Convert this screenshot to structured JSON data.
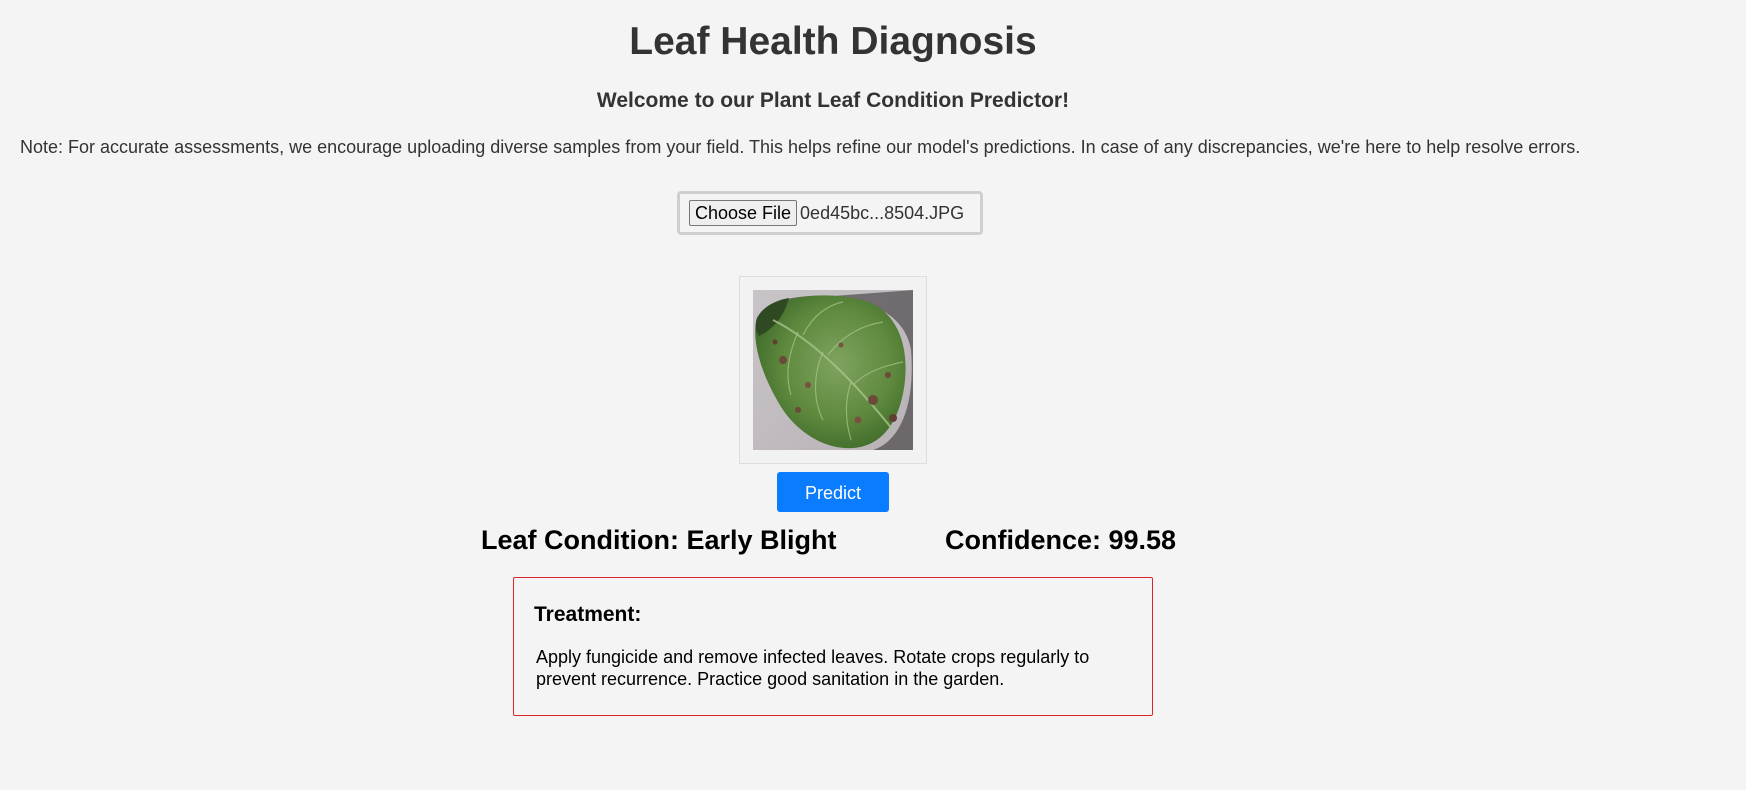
{
  "header": {
    "title": "Leaf Health Diagnosis",
    "welcome": "Welcome to our Plant Leaf Condition Predictor!",
    "note": "Note: For accurate assessments, we encourage uploading diverse samples from your field. This helps refine our model's predictions. In case of any discrepancies, we're here to help resolve errors."
  },
  "upload": {
    "button_label": "Choose File",
    "file_name": "0ed45bc...8504.JPG"
  },
  "preview": {
    "image_semantic": "leaf-photo"
  },
  "actions": {
    "predict_label": "Predict"
  },
  "result": {
    "condition_text": "Leaf Condition: Early Blight",
    "confidence_text": "Confidence: 99.58"
  },
  "treatment": {
    "title": "Treatment:",
    "text": "Apply fungicide and remove infected leaves. Rotate crops regularly to prevent recurrence. Practice good sanitation in the garden."
  },
  "colors": {
    "background": "#f4f4f4",
    "accent": "#0a7cff",
    "treatment_border": "#d9262c"
  }
}
